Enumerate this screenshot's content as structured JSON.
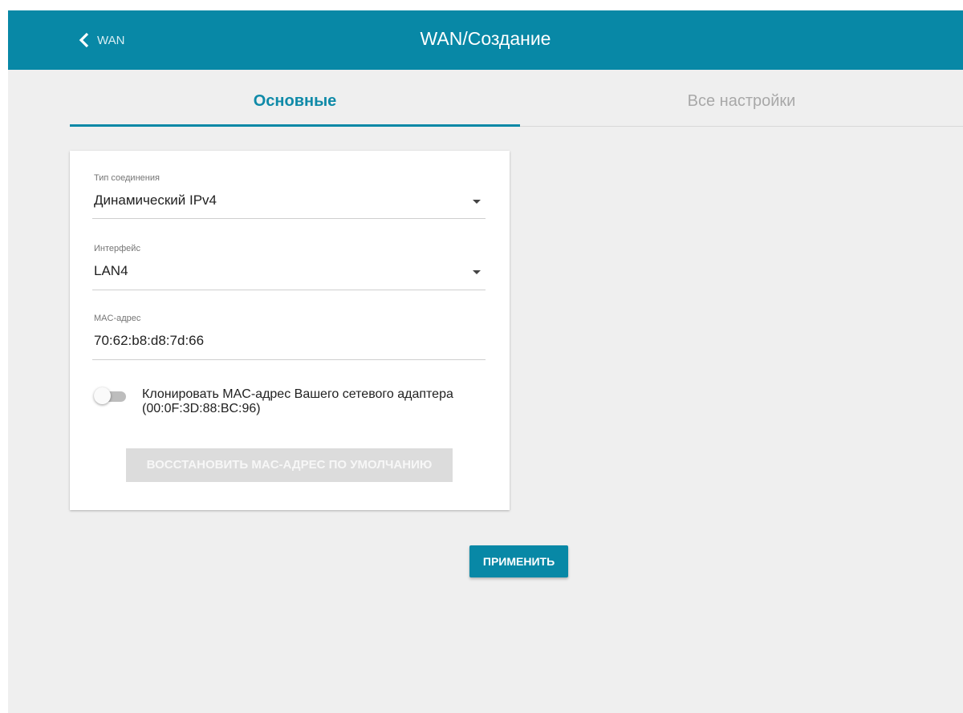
{
  "header": {
    "back_label": "WAN",
    "title": "WAN/Создание"
  },
  "tabs": [
    {
      "label": "Основные",
      "active": true
    },
    {
      "label": "Все настройки",
      "active": false
    }
  ],
  "form": {
    "connection_type": {
      "label": "Тип соединения",
      "value": "Динамический IPv4"
    },
    "interface": {
      "label": "Интерфейс",
      "value": "LAN4"
    },
    "mac_address": {
      "label": "MAC-адрес",
      "value": "70:62:b8:d8:7d:66"
    },
    "clone_mac": {
      "label": "Клонировать MAC-адрес Вашего сетевого адаптера (00:0F:3D:88:BC:96)",
      "enabled": false
    },
    "restore_button": "ВОССТАНОВИТЬ MAC-АДРЕС ПО УМОЛЧАНИЮ"
  },
  "apply_button": "ПРИМЕНИТЬ",
  "colors": {
    "accent": "#0888a6",
    "background": "#efefef",
    "card": "#ffffff",
    "disabled_button": "#dcdcdc"
  },
  "icons": {
    "back": "chevron-left-icon",
    "dropdown": "caret-down-icon"
  }
}
